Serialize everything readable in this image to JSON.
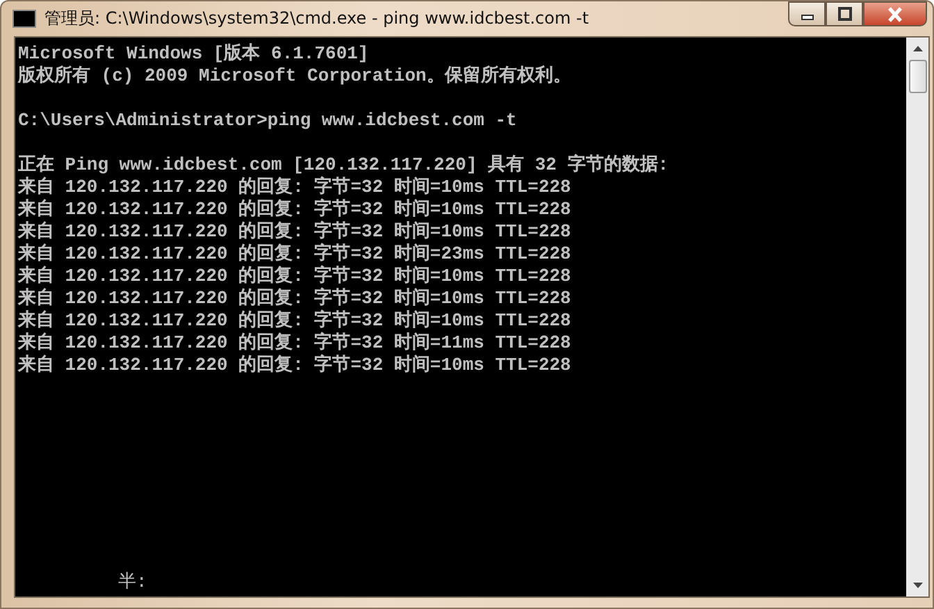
{
  "window": {
    "title": "管理员: C:\\Windows\\system32\\cmd.exe - ping  www.idcbest.com -t"
  },
  "console": {
    "blocks": [
      [
        "Microsoft Windows [版本 6.1.7601]",
        "版权所有 (c) 2009 Microsoft Corporation。保留所有权利。"
      ],
      [
        "C:\\Users\\Administrator>ping www.idcbest.com -t"
      ],
      [
        "正在 Ping www.idcbest.com [120.132.117.220] 具有 32 字节的数据:",
        "来自 120.132.117.220 的回复: 字节=32 时间=10ms TTL=228",
        "来自 120.132.117.220 的回复: 字节=32 时间=10ms TTL=228",
        "来自 120.132.117.220 的回复: 字节=32 时间=10ms TTL=228",
        "来自 120.132.117.220 的回复: 字节=32 时间=23ms TTL=228",
        "来自 120.132.117.220 的回复: 字节=32 时间=10ms TTL=228",
        "来自 120.132.117.220 的回复: 字节=32 时间=10ms TTL=228",
        "来自 120.132.117.220 的回复: 字节=32 时间=10ms TTL=228",
        "来自 120.132.117.220 的回复: 字节=32 时间=11ms TTL=228",
        "来自 120.132.117.220 的回复: 字节=32 时间=10ms TTL=228"
      ]
    ],
    "ime_status": "半:"
  }
}
